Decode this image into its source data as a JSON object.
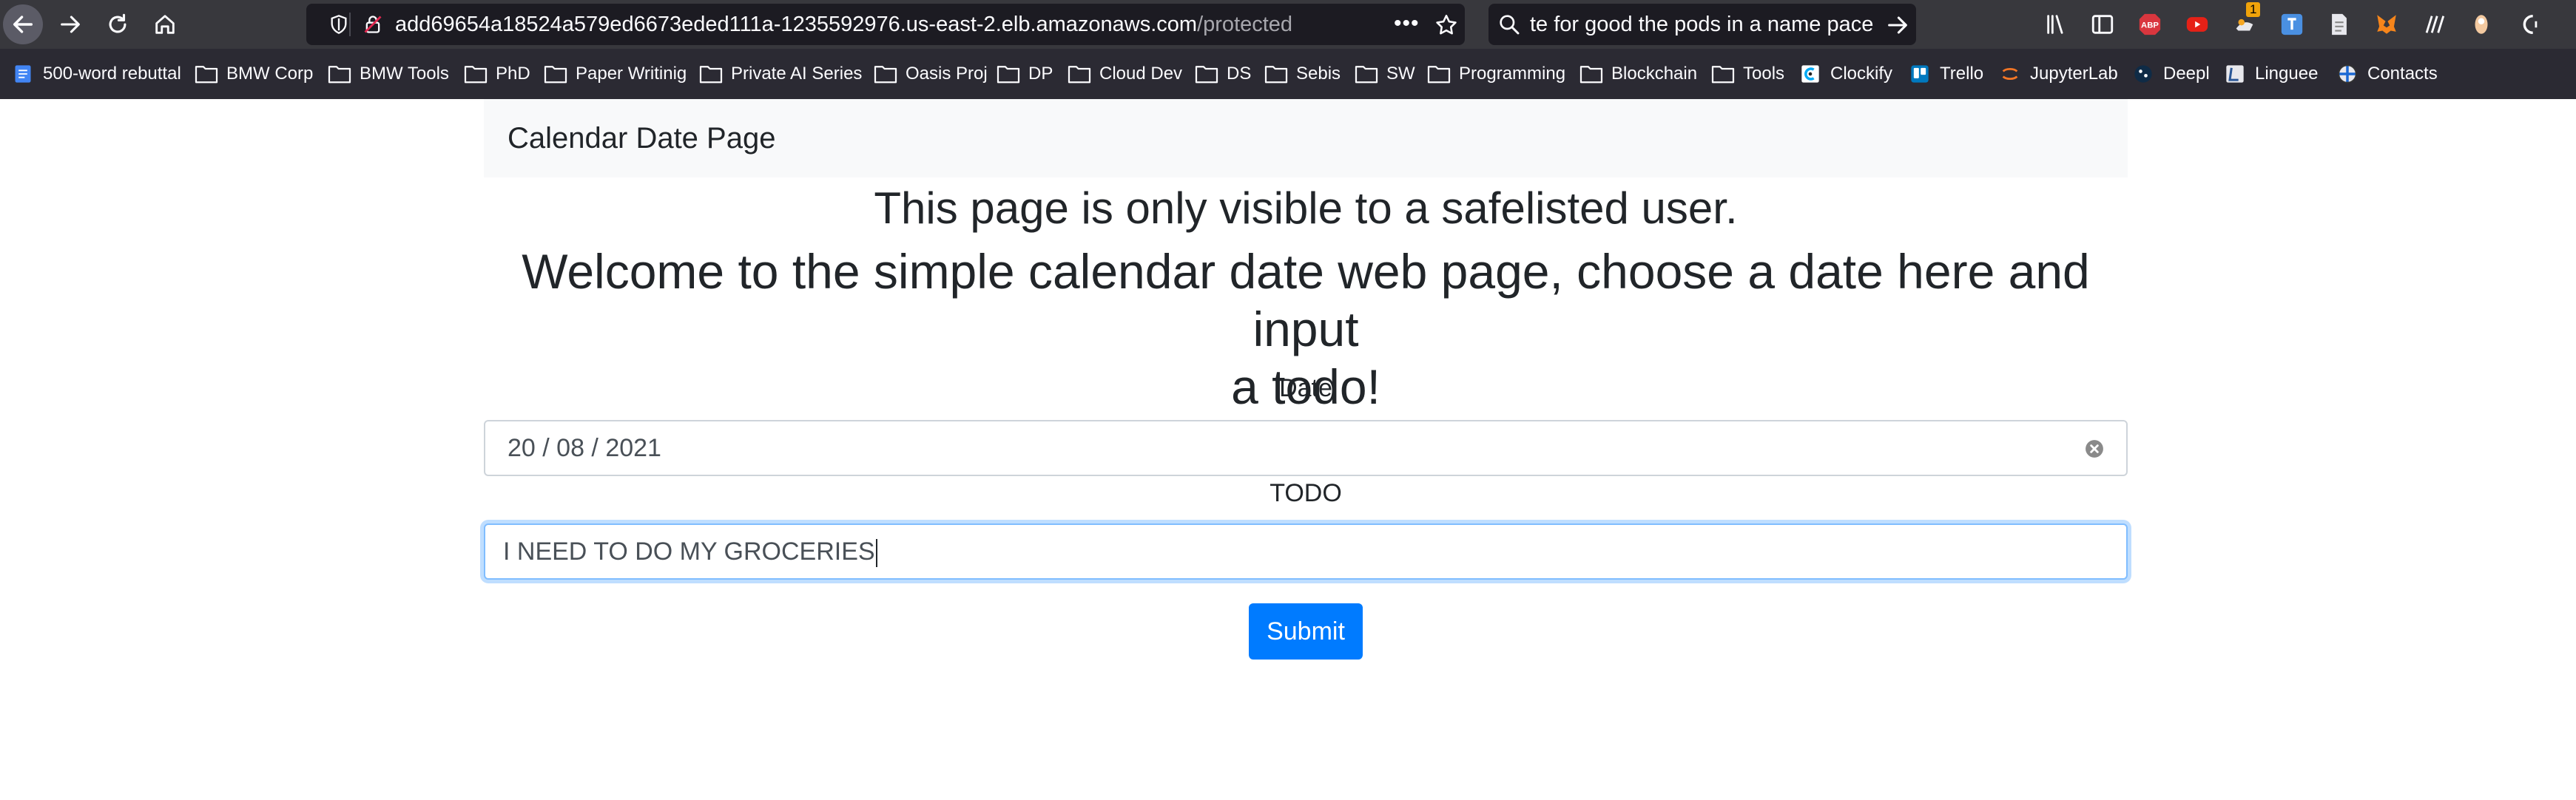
{
  "browser": {
    "url_host": "add69654a18524a579ed6673eded111a-1235592976.us-east-2.elb.amazonaws.com",
    "url_path": "/protected",
    "search_text": "te for good the pods in a name pace",
    "page_actions_label": "•••",
    "extension_badge": "1",
    "icons": [
      "back-arrow-icon",
      "forward-arrow-icon",
      "reload-icon",
      "home-icon",
      "tracking-shield-icon",
      "insecure-lock-icon",
      "bookmark-star-icon",
      "search-icon",
      "search-go-arrow-icon",
      "library-icon",
      "sidebar-icon",
      "adblock-icon",
      "youtube-icon",
      "extension-icon",
      "translate-icon",
      "reader-icon",
      "metamask-icon",
      "zotero-icon",
      "extension-icon-2",
      "extension-icon-3"
    ]
  },
  "bookmarks": [
    {
      "label": "500-word rebuttal",
      "icon": "docs-icon"
    },
    {
      "label": "BMW Corp",
      "icon": "folder-icon"
    },
    {
      "label": "BMW Tools",
      "icon": "folder-icon"
    },
    {
      "label": "PhD",
      "icon": "folder-icon"
    },
    {
      "label": "Paper Writinig",
      "icon": "folder-icon"
    },
    {
      "label": "Private AI Series",
      "icon": "folder-icon"
    },
    {
      "label": "Oasis Proj",
      "icon": "folder-icon"
    },
    {
      "label": "DP",
      "icon": "folder-icon"
    },
    {
      "label": "Cloud Dev",
      "icon": "folder-icon"
    },
    {
      "label": "DS",
      "icon": "folder-icon"
    },
    {
      "label": "Sebis",
      "icon": "folder-icon"
    },
    {
      "label": "SW",
      "icon": "folder-icon"
    },
    {
      "label": "Programming",
      "icon": "folder-icon"
    },
    {
      "label": "Blockchain",
      "icon": "folder-icon"
    },
    {
      "label": "Tools",
      "icon": "folder-icon"
    },
    {
      "label": "Clockify",
      "icon": "clockify-icon"
    },
    {
      "label": "Trello",
      "icon": "trello-icon"
    },
    {
      "label": "JupyterLab",
      "icon": "jupyter-icon"
    },
    {
      "label": "Deepl",
      "icon": "deepl-icon"
    },
    {
      "label": "Linguee",
      "icon": "linguee-icon"
    },
    {
      "label": "Contacts",
      "icon": "contacts-icon"
    }
  ],
  "page": {
    "brand": "Calendar Date Page",
    "safelist_notice": "This page is only visible to a safelisted user.",
    "welcome_line1": "Welcome to the simple calendar date web page, choose a date here and input",
    "welcome_line2": "a todo!",
    "date_label": "Date",
    "date_value": "20 / 08 / 2021",
    "todo_label": "TODO",
    "todo_value": "I NEED TO DO MY GROCERIES",
    "submit_label": "Submit"
  },
  "colors": {
    "toolbar_bg": "#38383d",
    "bookmarks_bg": "#2b2a33",
    "urlbar_bg": "#1c1b22",
    "navbar_bg": "#f8f9fa",
    "primary": "#007bff",
    "focus_border": "#80bdff"
  }
}
